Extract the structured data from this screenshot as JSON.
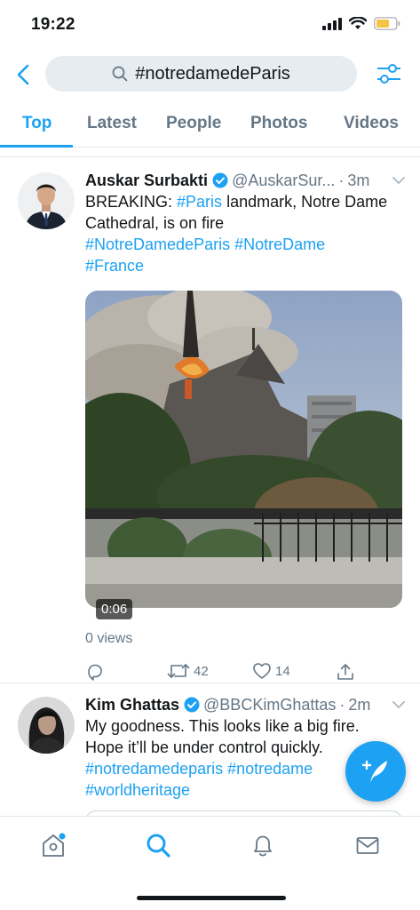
{
  "status_bar": {
    "time": "19:22"
  },
  "search": {
    "query": "#notredamedeParis"
  },
  "tabs": [
    {
      "label": "Top"
    },
    {
      "label": "Latest"
    },
    {
      "label": "People"
    },
    {
      "label": "Photos"
    },
    {
      "label": "Videos"
    }
  ],
  "tweets": [
    {
      "name": "Auskar Surbakti",
      "handle": "@AuskarSur...",
      "dot": "·",
      "time": "3m",
      "text_prefix": "BREAKING: ",
      "text_tag1": "#Paris",
      "text_rest": " landmark, Notre Dame Cathedral, is on fire",
      "hashtags": [
        "#NotreDamedeParis",
        "#NotreDame",
        "#France"
      ],
      "video_duration": "0:06",
      "views": "0 views",
      "retweets": "42",
      "likes": "14"
    },
    {
      "name": "Kim Ghattas",
      "handle": "@BBCKimGhattas",
      "dot": "·",
      "time": "2m",
      "text": "My goodness. This looks like a big fire. Hope it’ll be under control quickly.",
      "hashtags": [
        "#notredamedeparis",
        "#notredame",
        "#worldheritage"
      ]
    }
  ],
  "colors": {
    "accent": "#1da1f2",
    "text_primary": "#14171a",
    "text_secondary": "#657786",
    "border": "#e1e8ed",
    "search_bg": "#e6ecf0"
  },
  "icons": {
    "back": "chevron-left-icon",
    "search": "search-icon",
    "filter": "sliders-icon",
    "verified": "verified-badge-icon",
    "caret": "chevron-down-icon",
    "reply": "reply-icon",
    "retweet": "retweet-icon",
    "like": "heart-icon",
    "share": "share-icon",
    "compose": "compose-feather-icon",
    "nav": [
      "home-icon",
      "search-icon",
      "notifications-bell-icon",
      "messages-envelope-icon"
    ]
  }
}
